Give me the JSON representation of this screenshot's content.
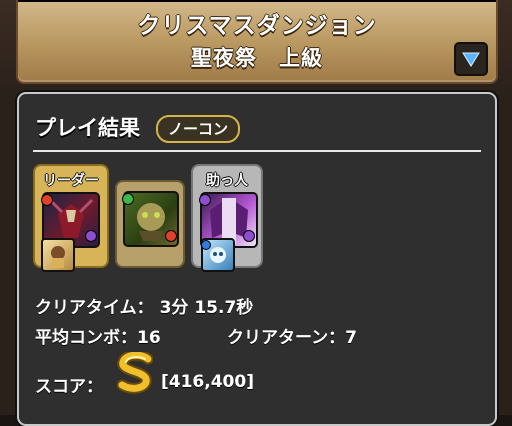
{
  "header": {
    "title": "クリスマスダンジョン",
    "subtitle": "聖夜祭　上級",
    "dropdown_icon": "triangle-down-icon"
  },
  "result": {
    "title": "プレイ結果",
    "badge": "ノーコン",
    "team": {
      "leader_label": "リーダー",
      "helper_label": "助っ人"
    },
    "clear_time_label": "クリアタイム：",
    "clear_time_value": "3分 15.7秒",
    "avg_combo_label": "平均コンボ：",
    "avg_combo_value": "16",
    "clear_turn_label": "クリアターン：",
    "clear_turn_value": "7",
    "score_label": "スコア：",
    "score_rank": "S",
    "score_value": "[416,400]"
  },
  "colors": {
    "banner": "#b8965f",
    "panel_bg": "#2f2f2f",
    "leader_card": "#d6b457",
    "helper_card": "#b7b7b7",
    "rank_gold": "#e7b41f"
  }
}
